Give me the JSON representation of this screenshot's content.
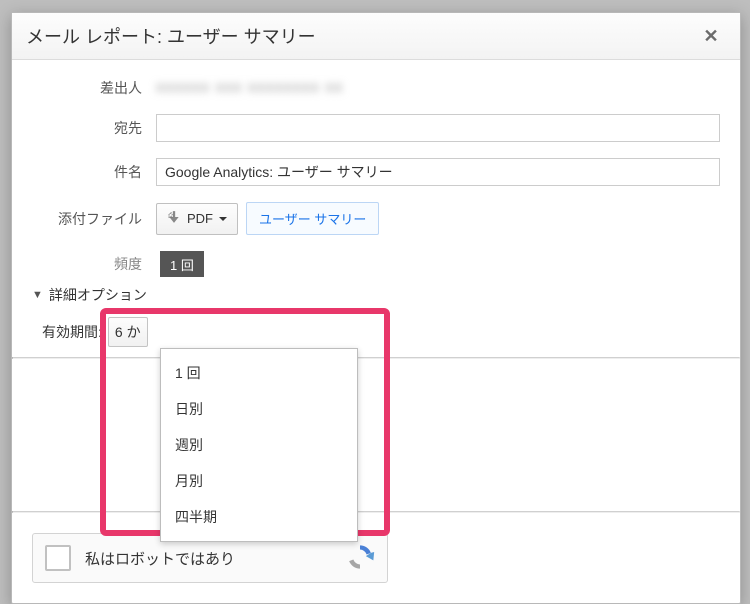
{
  "dialog": {
    "title": "メール レポート: ユーザー サマリー",
    "close_glyph": "✕"
  },
  "labels": {
    "sender": "差出人",
    "to": "宛先",
    "subject": "件名",
    "attachment": "添付ファイル",
    "frequency": "頻度",
    "advanced": "詳細オプション",
    "duration": "有効期間:"
  },
  "values": {
    "sender": "xxxxxx xxx xxxxxxxx xx",
    "to": "",
    "subject": "Google Analytics: ユーザー サマリー",
    "attachment_format": "PDF",
    "attachment_tag": "ユーザー サマリー",
    "frequency_selected": "1 回",
    "duration_selected": "6 か"
  },
  "frequency_options": [
    "1 回",
    "日別",
    "週別",
    "月別",
    "四半期"
  ],
  "captcha": {
    "text": "私はロボットではあり"
  }
}
